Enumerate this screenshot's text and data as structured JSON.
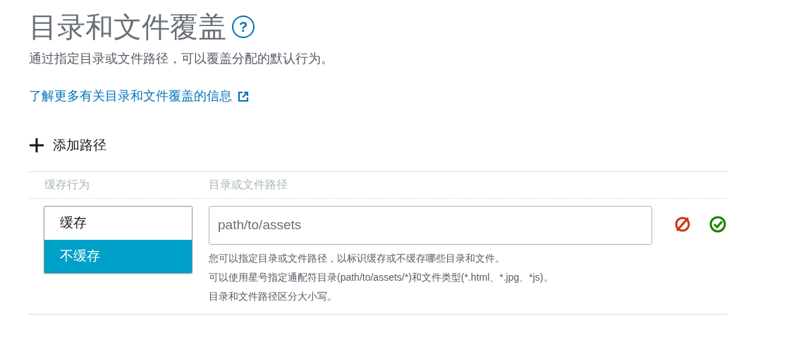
{
  "title": "目录和文件覆盖",
  "help_icon": "?",
  "description": "通过指定目录或文件路径，可以覆盖分配的默认行为。",
  "learn_more_link": "了解更多有关目录和文件覆盖的信息",
  "add_path_button": "添加路径",
  "table": {
    "columns": [
      "缓存行为",
      "目录或文件路径"
    ],
    "rows": [
      {
        "behavior_options": [
          {
            "label": "缓存",
            "selected": false
          },
          {
            "label": "不缓存",
            "selected": true
          }
        ],
        "path_placeholder": "path/to/assets",
        "hints": [
          "您可以指定目录或文件路径，以标识缓存或不缓存哪些目录和文件。",
          "可以使用星号指定通配符目录(path/to/assets/*)和文件类型(*.html、*.jpg、*js)。",
          "目录和文件路径区分大小写。"
        ]
      }
    ]
  }
}
